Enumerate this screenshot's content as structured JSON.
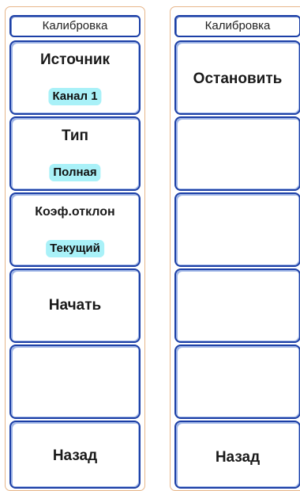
{
  "left_menu": {
    "title": "Калибровка",
    "keys": [
      {
        "label": "Источник",
        "value": "Канал 1"
      },
      {
        "label": "Тип",
        "value": "Полная"
      },
      {
        "label": "Коэф.отклон",
        "value": "Текущий"
      },
      {
        "label": "Начать"
      },
      {
        "label": ""
      },
      {
        "label": "Назад"
      }
    ]
  },
  "right_menu": {
    "title": "Калибровка",
    "keys": [
      {
        "label": "Остановить"
      },
      {
        "label": ""
      },
      {
        "label": ""
      },
      {
        "label": ""
      },
      {
        "label": ""
      },
      {
        "label": "Назад"
      }
    ]
  },
  "colors": {
    "border": "#1c3fa6",
    "panel_frame": "#e7b68a",
    "value_highlight": "#a9f1f8"
  }
}
